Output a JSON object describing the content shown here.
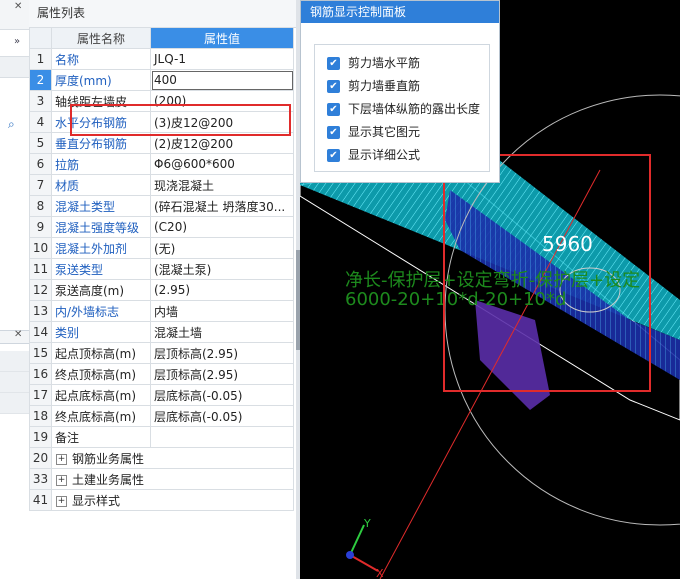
{
  "property_panel": {
    "title": "属性列表",
    "header": {
      "name_col": "属性名称",
      "value_col": "属性值"
    },
    "rows": [
      {
        "num": "1",
        "name": "名称",
        "value": "JLQ-1",
        "blue": true
      },
      {
        "num": "2",
        "name": "厚度(mm)",
        "value": "400",
        "blue": true,
        "selected": true
      },
      {
        "num": "3",
        "name": "轴线距左墙皮",
        "value": "(200)",
        "blue": false
      },
      {
        "num": "4",
        "name": "水平分布钢筋",
        "value": "(3)⽪12@200",
        "blue": true
      },
      {
        "num": "5",
        "name": "垂直分布钢筋",
        "value": "(2)⽪12@200",
        "blue": true
      },
      {
        "num": "6",
        "name": "拉筋",
        "value": "Φ6@600*600",
        "blue": true
      },
      {
        "num": "7",
        "name": "材质",
        "value": "现浇混凝土",
        "blue": true
      },
      {
        "num": "8",
        "name": "混凝土类型",
        "value": "(碎石混凝土 坍落度30...",
        "blue": true
      },
      {
        "num": "9",
        "name": "混凝土强度等级",
        "value": "(C20)",
        "blue": true
      },
      {
        "num": "10",
        "name": "混凝土外加剂",
        "value": "(无)",
        "blue": true
      },
      {
        "num": "11",
        "name": "泵送类型",
        "value": "(混凝土泵)",
        "blue": true
      },
      {
        "num": "12",
        "name": "泵送高度(m)",
        "value": "(2.95)",
        "blue": false
      },
      {
        "num": "13",
        "name": "内/外墙标志",
        "value": "内墙",
        "blue": true
      },
      {
        "num": "14",
        "name": "类别",
        "value": "混凝土墙",
        "blue": true
      },
      {
        "num": "15",
        "name": "起点顶标高(m)",
        "value": "层顶标高(2.95)",
        "blue": false
      },
      {
        "num": "16",
        "name": "终点顶标高(m)",
        "value": "层顶标高(2.95)",
        "blue": false
      },
      {
        "num": "17",
        "name": "起点底标高(m)",
        "value": "层底标高(-0.05)",
        "blue": false
      },
      {
        "num": "18",
        "name": "终点底标高(m)",
        "value": "层底标高(-0.05)",
        "blue": false
      },
      {
        "num": "19",
        "name": "备注",
        "value": "",
        "blue": false
      }
    ],
    "groups": [
      {
        "num": "20",
        "name": "钢筋业务属性"
      },
      {
        "num": "33",
        "name": "土建业务属性"
      },
      {
        "num": "41",
        "name": "显示样式"
      }
    ]
  },
  "control_panel": {
    "title": "钢筋显示控制面板",
    "items": [
      {
        "label": "剪力墙水平筋",
        "checked": true
      },
      {
        "label": "剪力墙垂直筋",
        "checked": true
      },
      {
        "label": "下层墙体纵筋的露出长度",
        "checked": true
      },
      {
        "label": "显示其它图元",
        "checked": true
      },
      {
        "label": "显示详细公式",
        "checked": true
      }
    ]
  },
  "view_3d": {
    "dimension": "5960",
    "formula_line1": "净长-保护层+设定弯折-保护层+设定",
    "formula_line2": "6000-20+10*d-20+10*d",
    "axis_y": "Y",
    "axis_x": "X"
  },
  "icons": {
    "left_chevron": "chevron-double-right-icon",
    "left_search": "search-icon",
    "close": "close-icon",
    "expand": "plus-icon",
    "check": "checkbox-checked-icon"
  }
}
